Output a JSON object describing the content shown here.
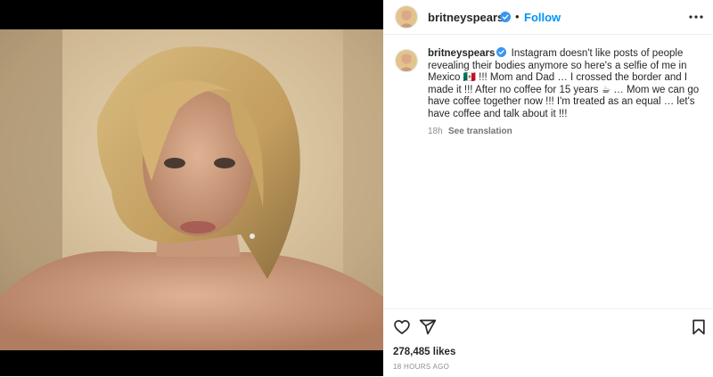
{
  "post": {
    "image_alt": "Selfie photo",
    "author": "britneyspears",
    "header": {
      "username": "britneyspears",
      "dot": "•",
      "follow_label": "Follow"
    },
    "caption": {
      "username": "britneyspears",
      "text": "Instagram doesn't like posts of people revealing their bodies anymore so here's a selfie of me in Mexico 🇲🇽 !!! Mom and Dad … I crossed the border and I made it !!! After no coffee for 15 years ☕ … Mom we can go have coffee together now !!! I'm treated as an equal … let's have coffee and talk about it !!!",
      "time": "18h",
      "translate_label": "See translation"
    },
    "likes": "278,485 likes",
    "posted_ago": "18 HOURS AGO"
  },
  "icons": {
    "verified": "verified-badge-icon",
    "more": "more-options-icon",
    "like": "heart-icon",
    "share": "share-icon",
    "save": "bookmark-icon"
  },
  "colors": {
    "accent": "#0095f6",
    "verified": "#3897f0",
    "muted": "#8e8e8e"
  }
}
